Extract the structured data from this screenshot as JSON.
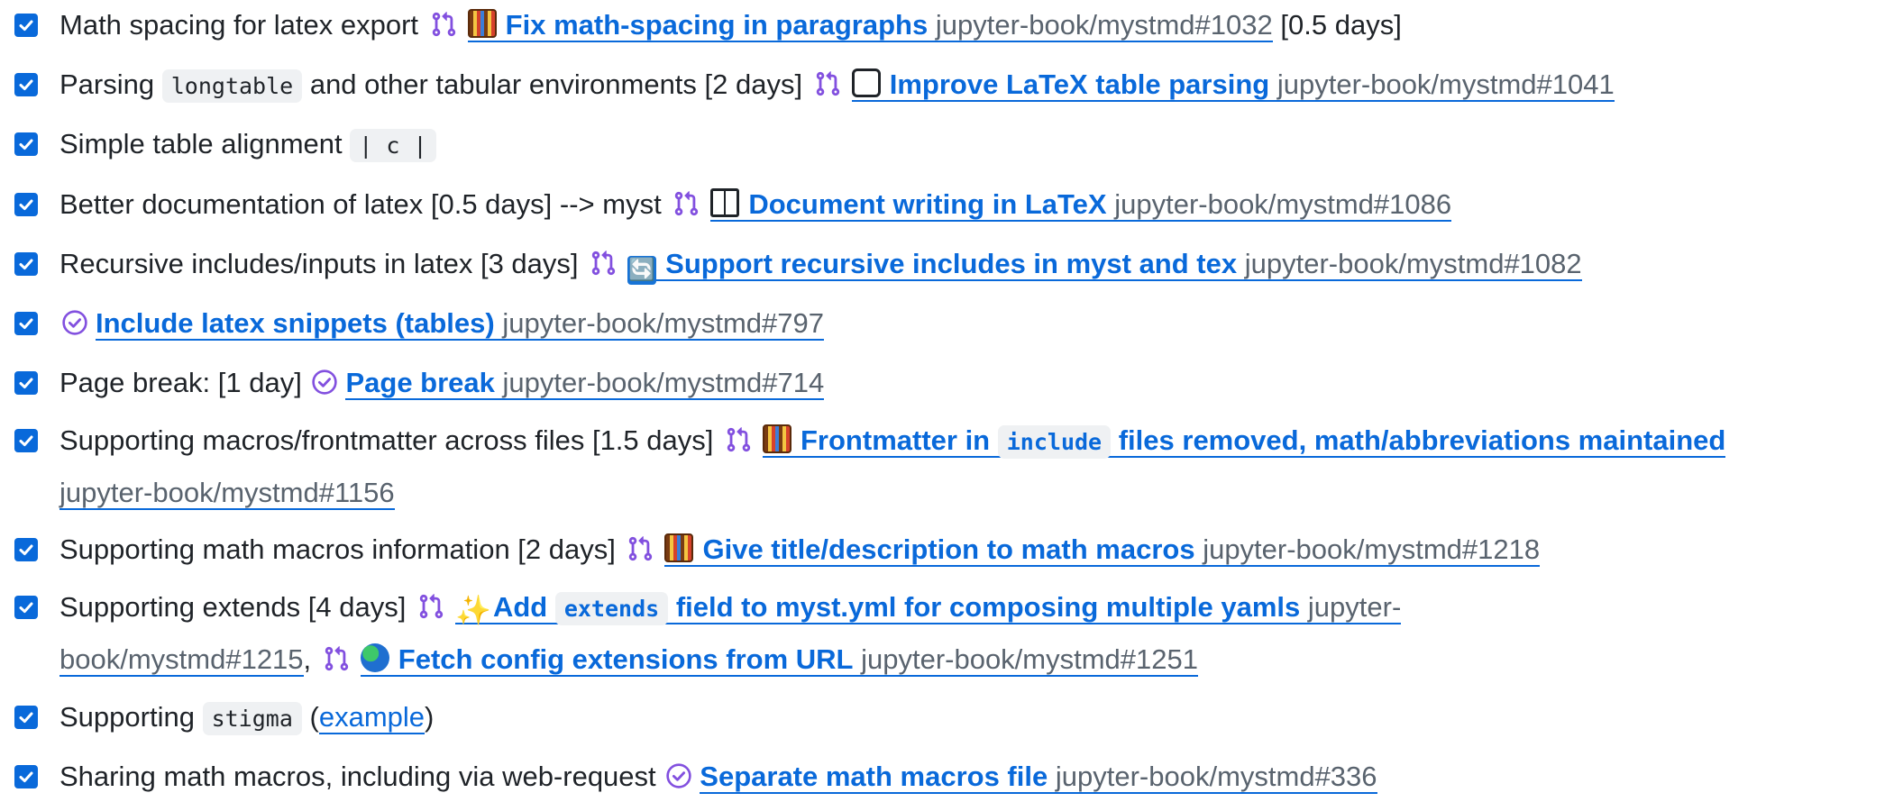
{
  "colors": {
    "link": "#0969da",
    "checkbox": "#0969da",
    "pr_icon": "#8250df",
    "issue_icon": "#8250df",
    "repo_text": "#59636e",
    "text": "#1f2328"
  },
  "tasks": [
    {
      "checked": true,
      "text_before": "Math spacing for latex export",
      "pr": {
        "emoji": "abacus",
        "title": "Fix math-spacing in paragraphs",
        "repo": "jupyter-book/mystmd#1032"
      },
      "text_after": "[0.5 days]"
    },
    {
      "checked": true,
      "text_before": "Parsing",
      "code": "longtable",
      "text_middle": "and other tabular environments [2 days]",
      "pr": {
        "emoji": "tray",
        "title": "Improve LaTeX table parsing",
        "repo": "jupyter-book/mystmd#1041"
      }
    },
    {
      "checked": true,
      "text_before": "Simple table alignment",
      "code": "| c |"
    },
    {
      "checked": true,
      "text_before": "Better documentation of latex [0.5 days] --> myst",
      "pr": {
        "emoji": "book",
        "title": "Document writing in LaTeX",
        "repo": "jupyter-book/mystmd#1086"
      }
    },
    {
      "checked": true,
      "text_before": "Recursive includes/inputs in latex [3 days]",
      "pr": {
        "emoji": "refresh",
        "emoji_glyph": "🔄",
        "title": "Support recursive includes in myst and tex",
        "repo": "jupyter-book/mystmd#1082"
      }
    },
    {
      "checked": true,
      "issue": {
        "title": "Include latex snippets (tables)",
        "repo": "jupyter-book/mystmd#797"
      }
    },
    {
      "checked": true,
      "text_before": "Page break: [1 day]",
      "issue": {
        "title": "Page break",
        "repo": "jupyter-book/mystmd#714"
      }
    },
    {
      "checked": true,
      "text_before": "Supporting macros/frontmatter across files [1.5 days]",
      "pr": {
        "emoji": "abacus",
        "title_before": "Frontmatter in",
        "title_code": "include",
        "title_after": "files removed, math/abbreviations maintained",
        "repo": "jupyter-book/mystmd#1156"
      }
    },
    {
      "checked": true,
      "text_before": "Supporting math macros information [2 days]",
      "pr": {
        "emoji": "abacus",
        "title": "Give title/description to math macros",
        "repo": "jupyter-book/mystmd#1218"
      }
    },
    {
      "checked": true,
      "text_before": "Supporting extends [4 days]",
      "pr": {
        "emoji": "sparkles",
        "emoji_glyph": "✨",
        "title_before": "Add",
        "title_code": "extends",
        "title_after": "field to myst.yml for composing multiple yamls",
        "repo": "jupyter-book/mystmd#1215"
      },
      "separator": ",",
      "pr2": {
        "emoji": "globe",
        "title": "Fetch config extensions from URL",
        "repo": "jupyter-book/mystmd#1251"
      }
    },
    {
      "checked": true,
      "text_before": "Supporting",
      "code": "stigma",
      "paren_open": "(",
      "link": "example",
      "paren_close": ")"
    },
    {
      "checked": true,
      "text_before": "Sharing math macros, including via web-request",
      "issue": {
        "title": "Separate math macros file",
        "repo": "jupyter-book/mystmd#336"
      }
    }
  ]
}
